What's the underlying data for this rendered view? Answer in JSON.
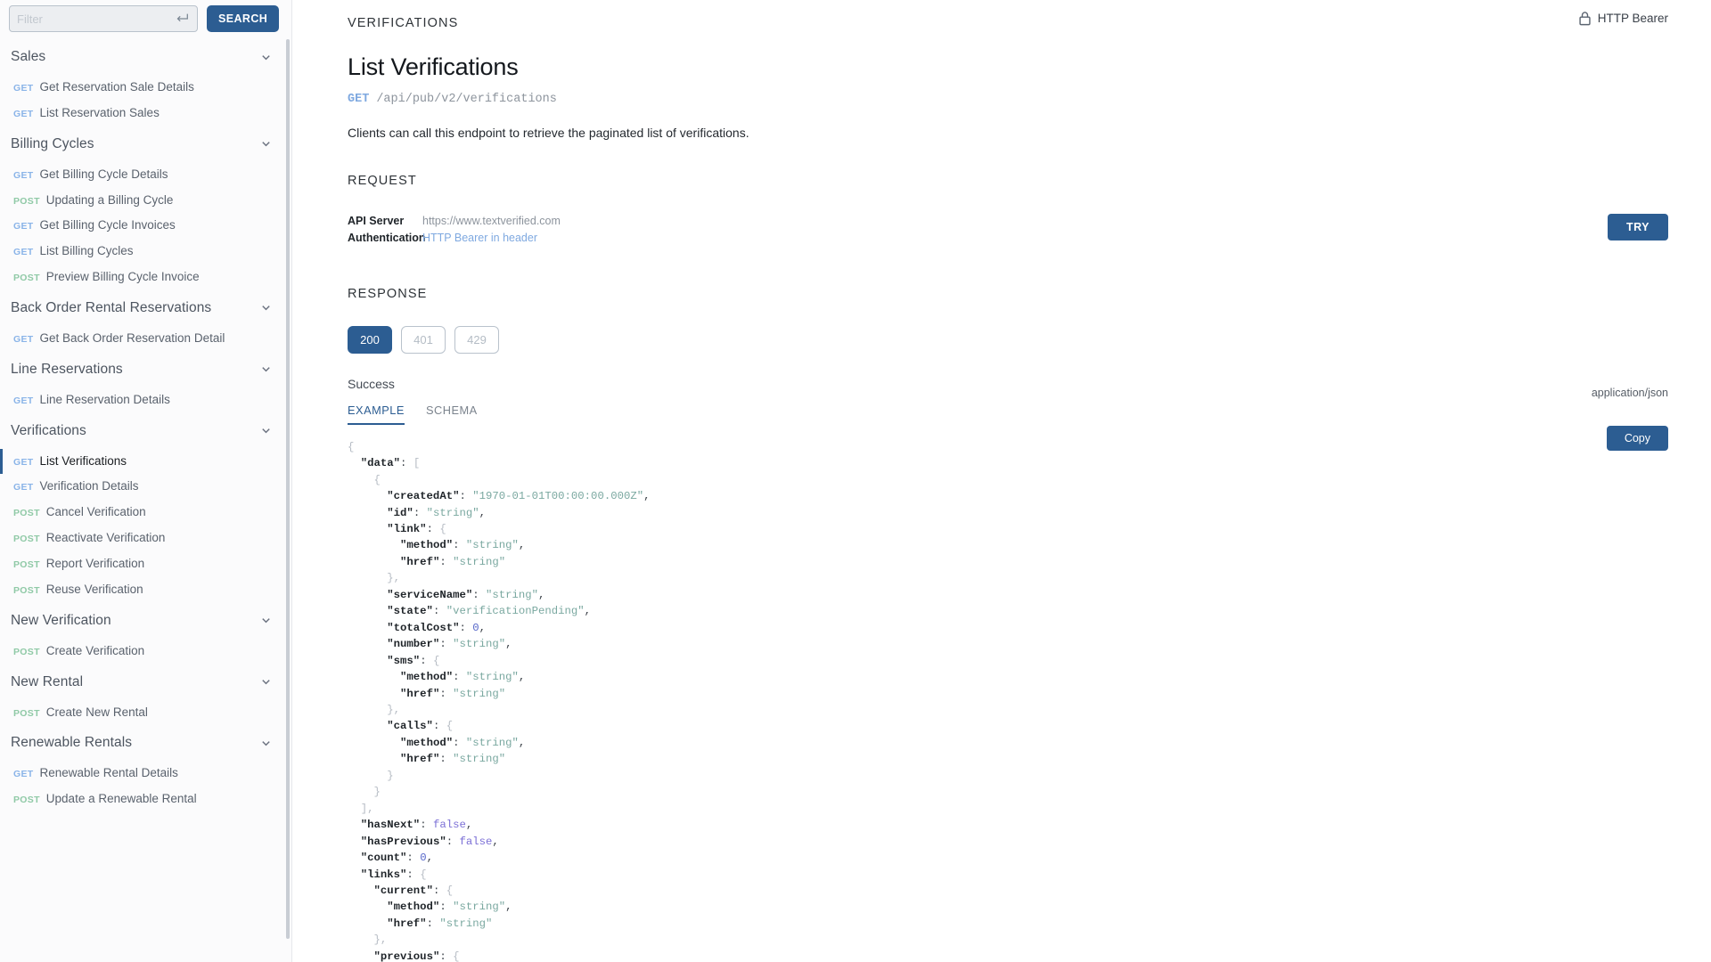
{
  "sidebar": {
    "search": {
      "placeholder": "Filter",
      "value": "",
      "button_label": "SEARCH",
      "enter_icon": "enter-return-icon"
    },
    "groups": [
      {
        "title": "Sales",
        "items": [
          {
            "verb": "GET",
            "label": "Get Reservation Sale Details",
            "active": false
          },
          {
            "verb": "GET",
            "label": "List Reservation Sales",
            "active": false
          }
        ]
      },
      {
        "title": "Billing Cycles",
        "items": [
          {
            "verb": "GET",
            "label": "Get Billing Cycle Details",
            "active": false
          },
          {
            "verb": "POST",
            "label": "Updating a Billing Cycle",
            "active": false
          },
          {
            "verb": "GET",
            "label": "Get Billing Cycle Invoices",
            "active": false
          },
          {
            "verb": "GET",
            "label": "List Billing Cycles",
            "active": false
          },
          {
            "verb": "POST",
            "label": "Preview Billing Cycle Invoice",
            "active": false
          }
        ]
      },
      {
        "title": "Back Order Rental Reservations",
        "items": [
          {
            "verb": "GET",
            "label": "Get Back Order Reservation Detail",
            "active": false
          }
        ]
      },
      {
        "title": "Line Reservations",
        "items": [
          {
            "verb": "GET",
            "label": "Line Reservation Details",
            "active": false
          }
        ]
      },
      {
        "title": "Verifications",
        "items": [
          {
            "verb": "GET",
            "label": "List Verifications",
            "active": true
          },
          {
            "verb": "GET",
            "label": "Verification Details",
            "active": false
          },
          {
            "verb": "POST",
            "label": "Cancel Verification",
            "active": false
          },
          {
            "verb": "POST",
            "label": "Reactivate Verification",
            "active": false
          },
          {
            "verb": "POST",
            "label": "Report Verification",
            "active": false
          },
          {
            "verb": "POST",
            "label": "Reuse Verification",
            "active": false
          }
        ]
      },
      {
        "title": "New Verification",
        "items": [
          {
            "verb": "POST",
            "label": "Create Verification",
            "active": false
          }
        ]
      },
      {
        "title": "New Rental",
        "items": [
          {
            "verb": "POST",
            "label": "Create New Rental",
            "active": false
          }
        ]
      },
      {
        "title": "Renewable Rentals",
        "items": [
          {
            "verb": "GET",
            "label": "Renewable Rental Details",
            "active": false
          },
          {
            "verb": "POST",
            "label": "Update a Renewable Rental",
            "active": false
          }
        ]
      }
    ]
  },
  "header": {
    "auth_badge": "HTTP Bearer",
    "lock_icon": "lock-icon"
  },
  "main": {
    "eyebrow": "VERIFICATIONS",
    "title": "List Verifications",
    "endpoint_verb": "GET",
    "endpoint_path": "/api/pub/v2/verifications",
    "description": "Clients can call this endpoint to retrieve the paginated list of verifications.",
    "request": {
      "heading": "REQUEST",
      "api_server_key": "API Server",
      "api_server_value": "https://www.textverified.com",
      "authentication_key": "Authentication",
      "authentication_value": "HTTP Bearer in header",
      "try_label": "TRY"
    },
    "response": {
      "heading": "RESPONSE",
      "status_tabs": [
        {
          "code": "200",
          "active": true
        },
        {
          "code": "401",
          "active": false
        },
        {
          "code": "429",
          "active": false
        }
      ],
      "status_text": "Success",
      "view_tabs": [
        {
          "label": "EXAMPLE",
          "active": true
        },
        {
          "label": "SCHEMA",
          "active": false
        }
      ],
      "mime_type": "application/json",
      "copy_label": "Copy",
      "example_lines": [
        [
          [
            "p",
            "{"
          ]
        ],
        [
          [
            "p",
            "  "
          ],
          [
            "k",
            "\"data\""
          ],
          [
            "pn",
            ": "
          ],
          [
            "p",
            "["
          ]
        ],
        [
          [
            "p",
            "    {"
          ]
        ],
        [
          [
            "p",
            "      "
          ],
          [
            "k",
            "\"createdAt\""
          ],
          [
            "pn",
            ": "
          ],
          [
            "s",
            "\"1970-01-01T00:00:00.000Z\""
          ],
          [
            "pn",
            ","
          ]
        ],
        [
          [
            "p",
            "      "
          ],
          [
            "k",
            "\"id\""
          ],
          [
            "pn",
            ": "
          ],
          [
            "s",
            "\"string\""
          ],
          [
            "pn",
            ","
          ]
        ],
        [
          [
            "p",
            "      "
          ],
          [
            "k",
            "\"link\""
          ],
          [
            "pn",
            ": "
          ],
          [
            "p",
            "{"
          ]
        ],
        [
          [
            "p",
            "        "
          ],
          [
            "k",
            "\"method\""
          ],
          [
            "pn",
            ": "
          ],
          [
            "s",
            "\"string\""
          ],
          [
            "pn",
            ","
          ]
        ],
        [
          [
            "p",
            "        "
          ],
          [
            "k",
            "\"href\""
          ],
          [
            "pn",
            ": "
          ],
          [
            "s",
            "\"string\""
          ]
        ],
        [
          [
            "p",
            "      },"
          ]
        ],
        [
          [
            "p",
            "      "
          ],
          [
            "k",
            "\"serviceName\""
          ],
          [
            "pn",
            ": "
          ],
          [
            "s",
            "\"string\""
          ],
          [
            "pn",
            ","
          ]
        ],
        [
          [
            "p",
            "      "
          ],
          [
            "k",
            "\"state\""
          ],
          [
            "pn",
            ": "
          ],
          [
            "s",
            "\"verificationPending\""
          ],
          [
            "pn",
            ","
          ]
        ],
        [
          [
            "p",
            "      "
          ],
          [
            "k",
            "\"totalCost\""
          ],
          [
            "pn",
            ": "
          ],
          [
            "n",
            "0"
          ],
          [
            "pn",
            ","
          ]
        ],
        [
          [
            "p",
            "      "
          ],
          [
            "k",
            "\"number\""
          ],
          [
            "pn",
            ": "
          ],
          [
            "s",
            "\"string\""
          ],
          [
            "pn",
            ","
          ]
        ],
        [
          [
            "p",
            "      "
          ],
          [
            "k",
            "\"sms\""
          ],
          [
            "pn",
            ": "
          ],
          [
            "p",
            "{"
          ]
        ],
        [
          [
            "p",
            "        "
          ],
          [
            "k",
            "\"method\""
          ],
          [
            "pn",
            ": "
          ],
          [
            "s",
            "\"string\""
          ],
          [
            "pn",
            ","
          ]
        ],
        [
          [
            "p",
            "        "
          ],
          [
            "k",
            "\"href\""
          ],
          [
            "pn",
            ": "
          ],
          [
            "s",
            "\"string\""
          ]
        ],
        [
          [
            "p",
            "      },"
          ]
        ],
        [
          [
            "p",
            "      "
          ],
          [
            "k",
            "\"calls\""
          ],
          [
            "pn",
            ": "
          ],
          [
            "p",
            "{"
          ]
        ],
        [
          [
            "p",
            "        "
          ],
          [
            "k",
            "\"method\""
          ],
          [
            "pn",
            ": "
          ],
          [
            "s",
            "\"string\""
          ],
          [
            "pn",
            ","
          ]
        ],
        [
          [
            "p",
            "        "
          ],
          [
            "k",
            "\"href\""
          ],
          [
            "pn",
            ": "
          ],
          [
            "s",
            "\"string\""
          ]
        ],
        [
          [
            "p",
            "      }"
          ]
        ],
        [
          [
            "p",
            "    }"
          ]
        ],
        [
          [
            "p",
            "  ],"
          ]
        ],
        [
          [
            "p",
            "  "
          ],
          [
            "k",
            "\"hasNext\""
          ],
          [
            "pn",
            ": "
          ],
          [
            "b",
            "false"
          ],
          [
            "pn",
            ","
          ]
        ],
        [
          [
            "p",
            "  "
          ],
          [
            "k",
            "\"hasPrevious\""
          ],
          [
            "pn",
            ": "
          ],
          [
            "b",
            "false"
          ],
          [
            "pn",
            ","
          ]
        ],
        [
          [
            "p",
            "  "
          ],
          [
            "k",
            "\"count\""
          ],
          [
            "pn",
            ": "
          ],
          [
            "n",
            "0"
          ],
          [
            "pn",
            ","
          ]
        ],
        [
          [
            "p",
            "  "
          ],
          [
            "k",
            "\"links\""
          ],
          [
            "pn",
            ": "
          ],
          [
            "p",
            "{"
          ]
        ],
        [
          [
            "p",
            "    "
          ],
          [
            "k",
            "\"current\""
          ],
          [
            "pn",
            ": "
          ],
          [
            "p",
            "{"
          ]
        ],
        [
          [
            "p",
            "      "
          ],
          [
            "k",
            "\"method\""
          ],
          [
            "pn",
            ": "
          ],
          [
            "s",
            "\"string\""
          ],
          [
            "pn",
            ","
          ]
        ],
        [
          [
            "p",
            "      "
          ],
          [
            "k",
            "\"href\""
          ],
          [
            "pn",
            ": "
          ],
          [
            "s",
            "\"string\""
          ]
        ],
        [
          [
            "p",
            "    },"
          ]
        ],
        [
          [
            "p",
            "    "
          ],
          [
            "k",
            "\"previous\""
          ],
          [
            "pn",
            ": "
          ],
          [
            "p",
            "{"
          ]
        ]
      ]
    }
  }
}
